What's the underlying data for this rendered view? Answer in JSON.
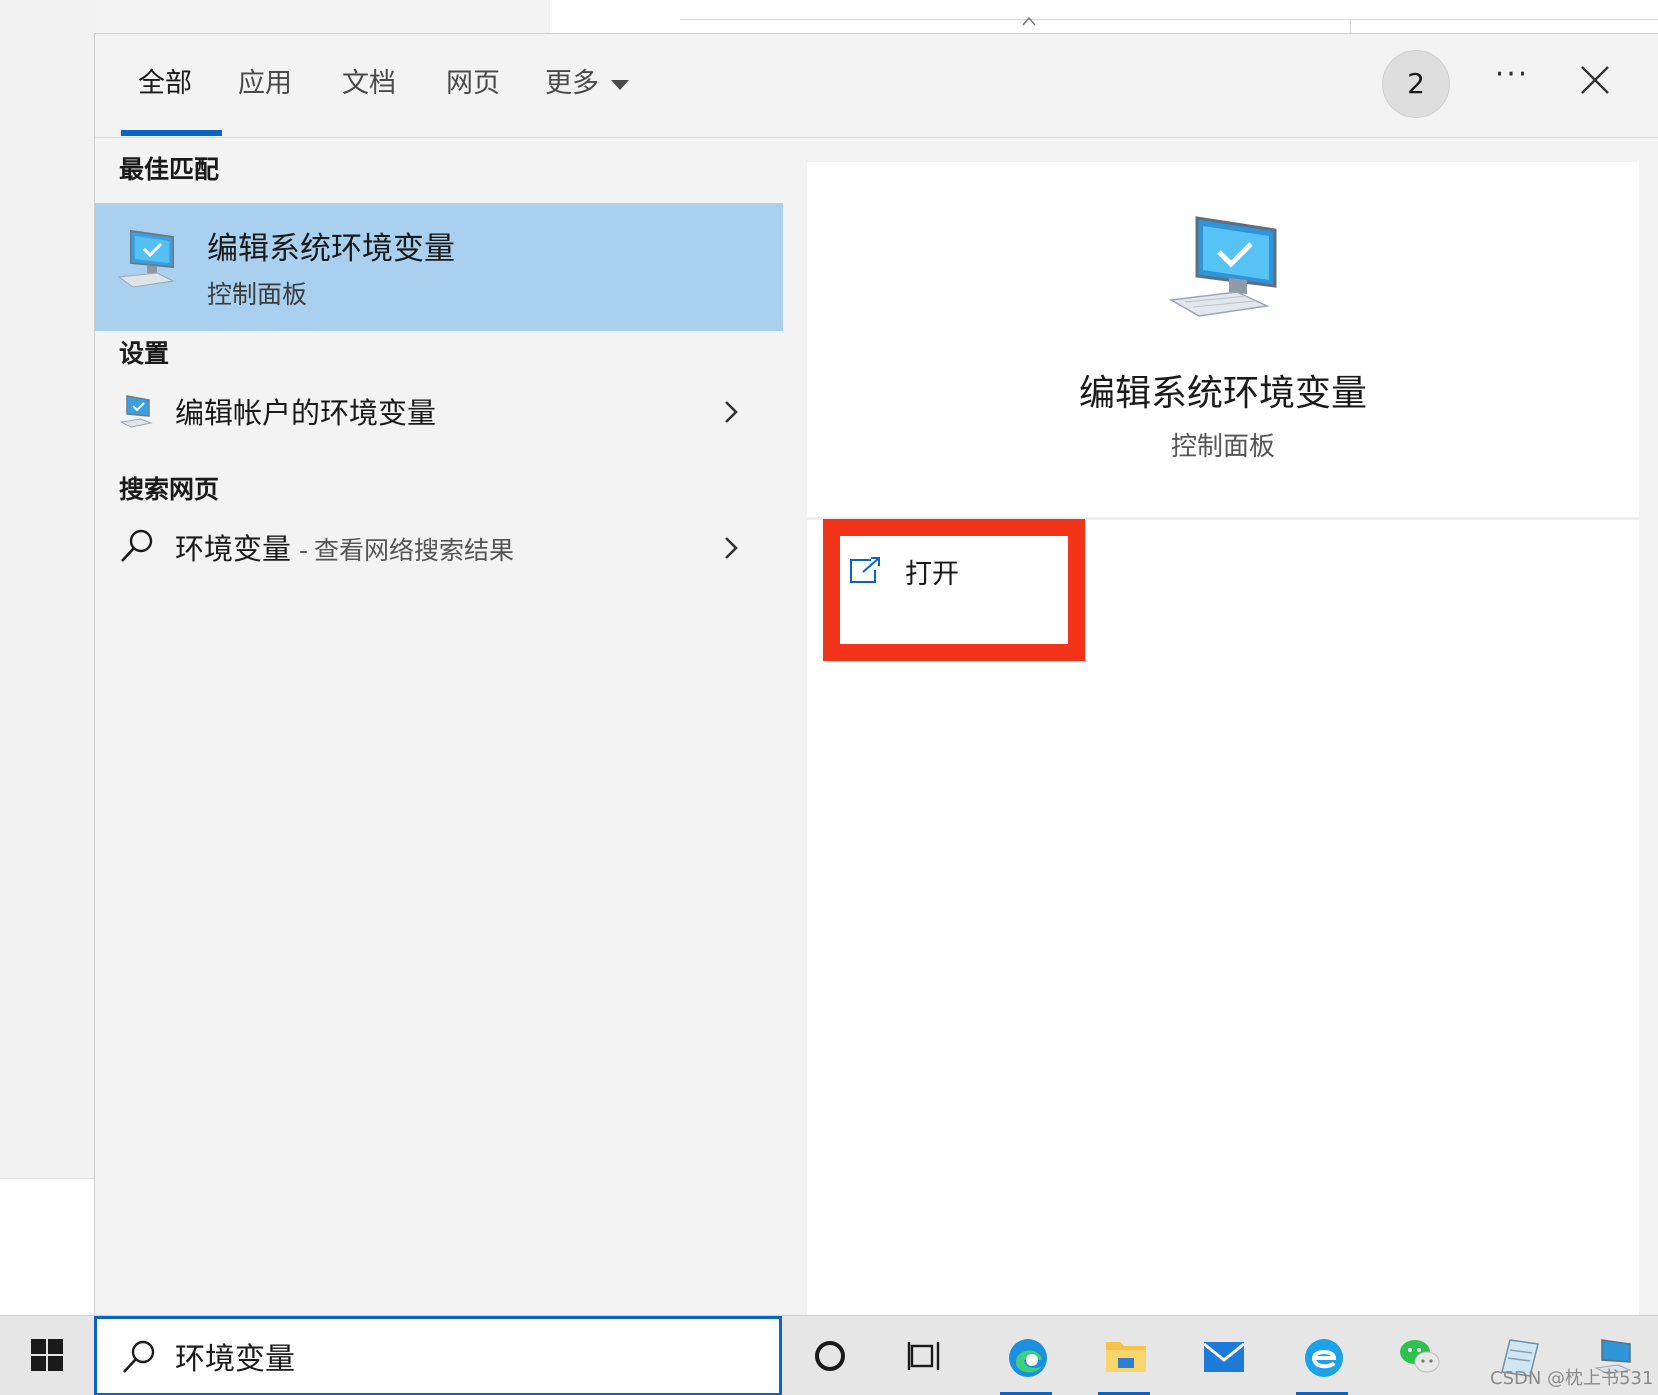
{
  "tabs": [
    {
      "label": "全部"
    },
    {
      "label": "应用"
    },
    {
      "label": "文档"
    },
    {
      "label": "网页"
    },
    {
      "label": "更多"
    }
  ],
  "badge_count": "2",
  "more_label": "···",
  "sections": {
    "best_match": "最佳匹配",
    "settings": "设置",
    "web_search": "搜索网页"
  },
  "best_match": {
    "title": "编辑系统环境变量",
    "subtitle": "控制面板"
  },
  "settings_item": {
    "label": "编辑帐户的环境变量"
  },
  "web_item": {
    "query": "环境变量",
    "dash": "-",
    "hint": "查看网络搜索结果"
  },
  "detail": {
    "title": "编辑系统环境变量",
    "subtitle": "控制面板",
    "action_open": "打开"
  },
  "search": {
    "value": "环境变量"
  },
  "watermark": "CSDN @枕上书531",
  "colors": {
    "accent": "#0a64c8",
    "selection": "#aad0f0",
    "highlight_box": "#f4341a"
  }
}
